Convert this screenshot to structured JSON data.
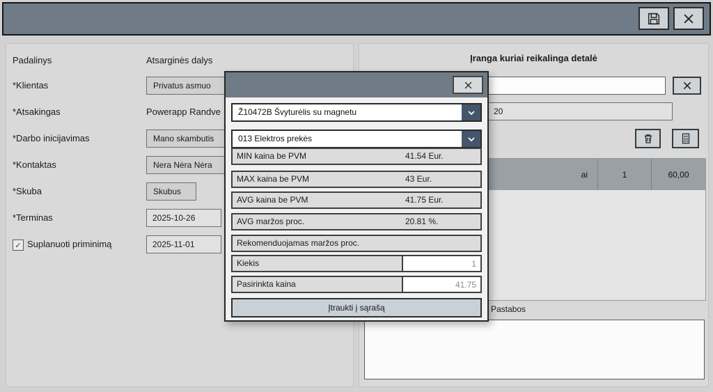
{
  "icons": {
    "save": "floppy-disk",
    "window_close": "x",
    "clear": "x",
    "trash": "trash-can",
    "calculator": "calculator",
    "dropdown": "chevron-down",
    "checkbox_check": "✓",
    "modal_close": "x"
  },
  "colors": {
    "titlebar": "#6f7b86",
    "dropdown_accent": "#44566b",
    "table_header": "#9aa0a5"
  },
  "left_panel": {
    "rows": [
      {
        "label": "Padalinys",
        "value": "Atsarginės dalys"
      },
      {
        "label": "*Klientas",
        "value": "Privatus asmuo"
      },
      {
        "label": "*Atsakingas",
        "value": "Powerapp Randve"
      },
      {
        "label": "*Darbo inicijavimas",
        "value": "Mano skambutis"
      },
      {
        "label": "*Kontaktas",
        "value": "Nera Nėra Nėra"
      },
      {
        "label": "*Skuba",
        "value": "Skubus"
      },
      {
        "label": "*Terminas",
        "value": "2025-10-26"
      },
      {
        "label": "Suplanuoti priminimą",
        "value": "2025-11-01",
        "checked": true
      }
    ]
  },
  "right_panel": {
    "title": "Įranga kuriai reikalinga detalė",
    "search_value": "",
    "quantity": "20",
    "table_row": {
      "name": "ai",
      "qty": "1",
      "price": "60,00"
    },
    "notes_label": "Pastabos"
  },
  "modal": {
    "product": "Ž10472B Švyturėlis su magnetu",
    "category": "013 Elektros prekės",
    "info_rows": [
      {
        "label": "MIN kaina be PVM",
        "value": "41.54 Eur."
      },
      {
        "label": "MAX kaina be PVM",
        "value": "43 Eur."
      },
      {
        "label": "AVG kaina be PVM",
        "value": "41.75 Eur."
      },
      {
        "label": "AVG maržos proc.",
        "value": "20.81 %."
      },
      {
        "label": "Rekomenduojamas maržos proc.",
        "value": ""
      }
    ],
    "quantity_label": "Kiekis",
    "quantity_value": "1",
    "price_label": "Pasirinkta kaina",
    "price_value": "41.75",
    "add_button": "Įtraukti į sąrašą"
  }
}
